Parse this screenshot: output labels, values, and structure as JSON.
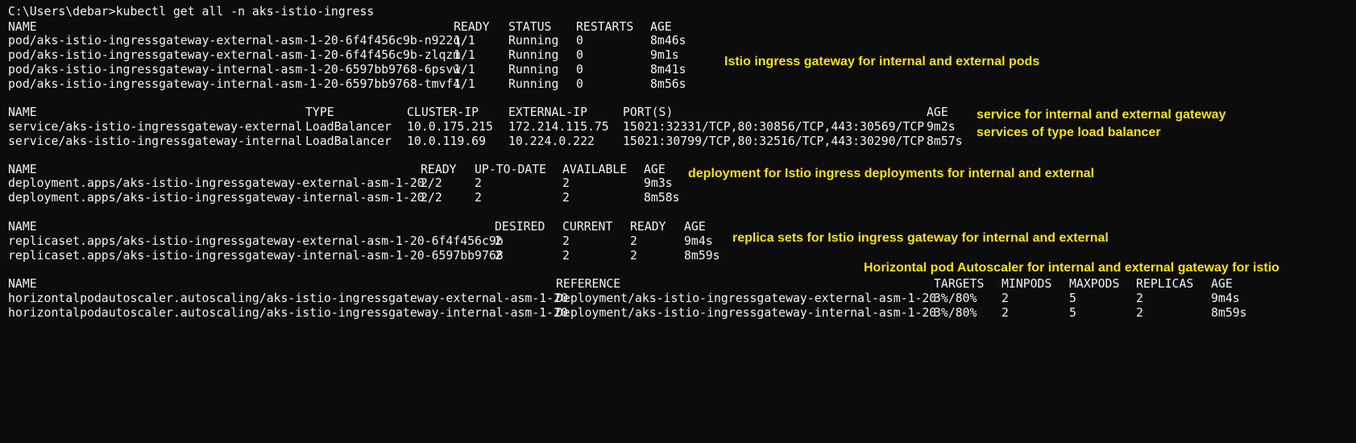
{
  "terminal": {
    "prompt": "C:\\Users\\debar>kubectl get all -n aks-istio-ingress",
    "background_color": "#0c0c0c",
    "text_color": "#f2f2f2",
    "annotation_color": "#f5e01a"
  },
  "pods": {
    "headers": [
      "NAME",
      "READY",
      "STATUS",
      "RESTARTS",
      "AGE"
    ],
    "rows": [
      [
        "pod/aks-istio-ingressgateway-external-asm-1-20-6f4f456c9b-n922q",
        "1/1",
        "Running",
        "0",
        "8m46s"
      ],
      [
        "pod/aks-istio-ingressgateway-external-asm-1-20-6f4f456c9b-zlqzm",
        "1/1",
        "Running",
        "0",
        "9m1s"
      ],
      [
        "pod/aks-istio-ingressgateway-internal-asm-1-20-6597bb9768-6psvw",
        "1/1",
        "Running",
        "0",
        "8m41s"
      ],
      [
        "pod/aks-istio-ingressgateway-internal-asm-1-20-6597bb9768-tmvf4",
        "1/1",
        "Running",
        "0",
        "8m56s"
      ]
    ]
  },
  "services": {
    "headers": [
      "NAME",
      "TYPE",
      "CLUSTER-IP",
      "EXTERNAL-IP",
      "PORT(S)",
      "AGE"
    ],
    "rows": [
      [
        "service/aks-istio-ingressgateway-external",
        "LoadBalancer",
        "10.0.175.215",
        "172.214.115.75",
        "15021:32331/TCP,80:30856/TCP,443:30569/TCP",
        "9m2s"
      ],
      [
        "service/aks-istio-ingressgateway-internal",
        "LoadBalancer",
        "10.0.119.69",
        "10.224.0.222",
        "15021:30799/TCP,80:32516/TCP,443:30290/TCP",
        "8m57s"
      ]
    ]
  },
  "deployments": {
    "headers": [
      "NAME",
      "READY",
      "UP-TO-DATE",
      "AVAILABLE",
      "AGE"
    ],
    "rows": [
      [
        "deployment.apps/aks-istio-ingressgateway-external-asm-1-20",
        "2/2",
        "2",
        "2",
        "9m3s"
      ],
      [
        "deployment.apps/aks-istio-ingressgateway-internal-asm-1-20",
        "2/2",
        "2",
        "2",
        "8m58s"
      ]
    ]
  },
  "replicasets": {
    "headers": [
      "NAME",
      "DESIRED",
      "CURRENT",
      "READY",
      "AGE"
    ],
    "rows": [
      [
        "replicaset.apps/aks-istio-ingressgateway-external-asm-1-20-6f4f456c9b",
        "2",
        "2",
        "2",
        "9m4s"
      ],
      [
        "replicaset.apps/aks-istio-ingressgateway-internal-asm-1-20-6597bb9768",
        "2",
        "2",
        "2",
        "8m59s"
      ]
    ]
  },
  "hpas": {
    "headers": [
      "NAME",
      "REFERENCE",
      "TARGETS",
      "MINPODS",
      "MAXPODS",
      "REPLICAS",
      "AGE"
    ],
    "rows": [
      [
        "horizontalpodautoscaler.autoscaling/aks-istio-ingressgateway-external-asm-1-20",
        "Deployment/aks-istio-ingressgateway-external-asm-1-20",
        "3%/80%",
        "2",
        "5",
        "2",
        "9m4s"
      ],
      [
        "horizontalpodautoscaler.autoscaling/aks-istio-ingressgateway-internal-asm-1-20",
        "Deployment/aks-istio-ingressgateway-internal-asm-1-20",
        "3%/80%",
        "2",
        "5",
        "2",
        "8m59s"
      ]
    ]
  },
  "annotations": {
    "pods": "Istio ingress gateway for internal and external pods",
    "services_line1": "service for internal and external gateway",
    "services_line2": "services of type load balancer",
    "deployments": "deployment for Istio ingress deployments for internal and external",
    "replicasets": "replica sets for Istio ingress gateway for internal and external",
    "hpas": "Horizontal pod Autoscaler for internal and external gateway for istio"
  }
}
